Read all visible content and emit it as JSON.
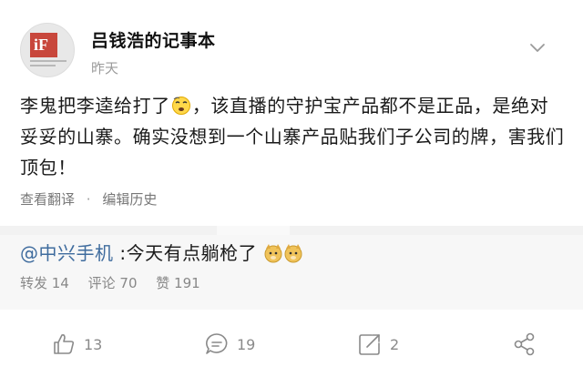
{
  "post": {
    "author": "吕钱浩的记事本",
    "time": "昨天",
    "avatar_logo_text": "iF",
    "body_part1": "李鬼把李逵给打了",
    "body_part2": "，该直播的守护宝产品都不是正品，是绝对妥妥的山寨。确实没想到一个山寨产品贴我们子公司的牌，害我们顶包！",
    "translate_link": "查看翻译",
    "separator": "·",
    "history_link": "编辑历史"
  },
  "repost": {
    "mention": "@中兴手机",
    "text": " :今天有点躺枪了",
    "reposts": "转发 14",
    "comments": "评论 70",
    "likes": "赞 191"
  },
  "actions": {
    "like_count": "13",
    "comment_count": "19",
    "share_count": "2"
  },
  "colors": {
    "mention": "#3f6c9e",
    "muted": "#8a8a8a",
    "avatar_logo": "#c8473c"
  }
}
